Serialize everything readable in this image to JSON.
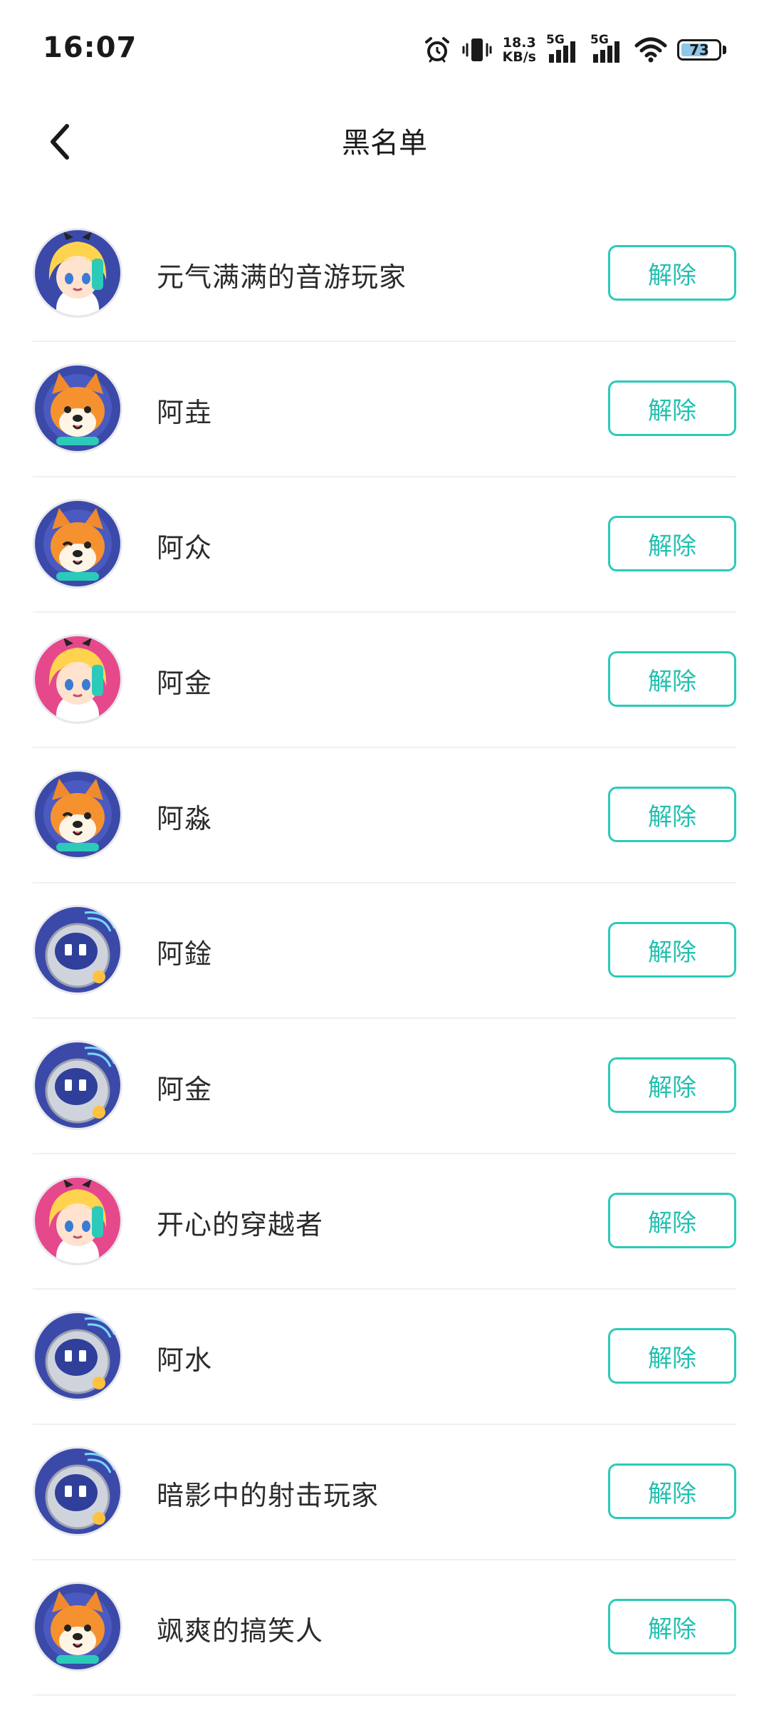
{
  "status_bar": {
    "time": "16:07",
    "net_speed_value": "18.3",
    "net_speed_unit": "KB/s",
    "signal1_label": "5G",
    "signal2_label": "5G",
    "battery_level": "73",
    "battery_fraction": 0.73
  },
  "header": {
    "title": "黑名单",
    "back_icon": "chevron-left-icon"
  },
  "blocked_users": [
    {
      "name": "元气满满的音游玩家",
      "avatar": "anime-girl-blue",
      "button": "解除"
    },
    {
      "name": "阿垚",
      "avatar": "shiba-dog",
      "button": "解除"
    },
    {
      "name": "阿众",
      "avatar": "shiba-dog-wink",
      "button": "解除"
    },
    {
      "name": "阿金",
      "avatar": "anime-girl-pink",
      "button": "解除"
    },
    {
      "name": "阿淼",
      "avatar": "shiba-dog-wink",
      "button": "解除"
    },
    {
      "name": "阿鍂",
      "avatar": "robot",
      "button": "解除"
    },
    {
      "name": "阿金",
      "avatar": "robot",
      "button": "解除"
    },
    {
      "name": "开心的穿越者",
      "avatar": "anime-girl-pink",
      "button": "解除"
    },
    {
      "name": "阿水",
      "avatar": "robot",
      "button": "解除"
    },
    {
      "name": "暗影中的射击玩家",
      "avatar": "robot",
      "button": "解除"
    },
    {
      "name": "飒爽的搞笑人",
      "avatar": "shiba-dog",
      "button": "解除"
    }
  ],
  "colors": {
    "accent": "#22c0b0",
    "avatar_blue": "#3b4aa8",
    "avatar_pink": "#e5498c",
    "avatar_yellow": "#ffd34d"
  }
}
